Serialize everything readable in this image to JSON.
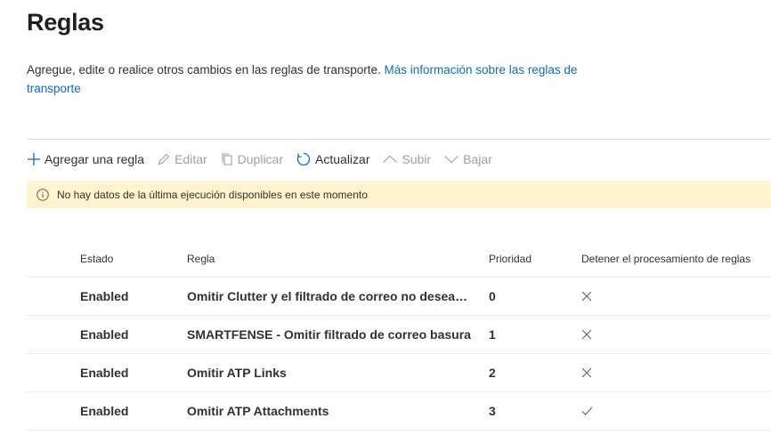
{
  "page": {
    "title": "Reglas",
    "description": "Agregue, edite o realice otros cambios en las reglas de transporte.",
    "link_text": "Más información sobre las reglas de transporte"
  },
  "toolbar": {
    "add": "Agregar una regla",
    "edit": "Editar",
    "duplicate": "Duplicar",
    "refresh": "Actualizar",
    "up": "Subir",
    "down": "Bajar"
  },
  "notice": {
    "text": "No hay datos de la última ejecución disponibles en este momento",
    "background": "#fff4ce"
  },
  "table": {
    "headers": {
      "estado": "Estado",
      "regla": "Regla",
      "prioridad": "Prioridad",
      "detener": "Detener el procesamiento de reglas"
    },
    "rows": [
      {
        "estado": "Enabled",
        "regla": "Omitir Clutter y el filtrado de correo no deseado para simulaciones de phishing",
        "prioridad": "0",
        "detener": "no",
        "detener_icon": "x-icon"
      },
      {
        "estado": "Enabled",
        "regla": "SMARTFENSE - Omitir filtrado de correo basura",
        "prioridad": "1",
        "detener": "no",
        "detener_icon": "x-icon"
      },
      {
        "estado": "Enabled",
        "regla": "Omitir ATP Links",
        "prioridad": "2",
        "detener": "no",
        "detener_icon": "x-icon"
      },
      {
        "estado": "Enabled",
        "regla": "Omitir ATP Attachments",
        "prioridad": "3",
        "detener": "yes",
        "detener_icon": "check-icon"
      }
    ]
  },
  "colors": {
    "link": "#0f6cbd",
    "refresh_icon": "#0f6cbd",
    "disabled": "#a19f9d"
  }
}
